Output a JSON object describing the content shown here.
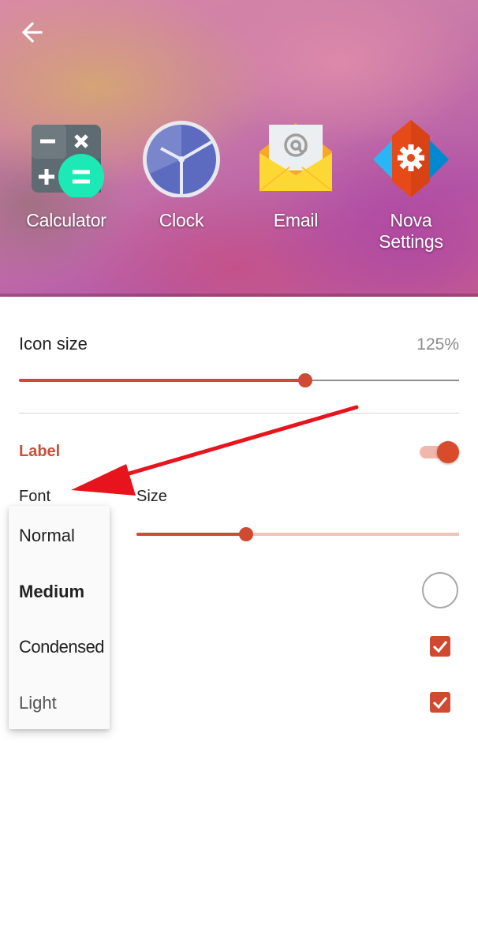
{
  "preview": {
    "apps": [
      {
        "label": "Calculator",
        "icon": "calculator-icon"
      },
      {
        "label": "Clock",
        "icon": "clock-icon"
      },
      {
        "label": "Email",
        "icon": "email-icon"
      },
      {
        "label": "Nova Settings",
        "icon": "nova-settings-icon"
      }
    ]
  },
  "icon_size": {
    "title": "Icon size",
    "value": "125%",
    "slider_fraction": 0.65
  },
  "label_section": {
    "title": "Label",
    "enabled": true,
    "font_label": "Font",
    "size_label": "Size",
    "size_slider_fraction": 0.34,
    "font_menu": [
      "Normal",
      "Medium",
      "Condensed",
      "Light"
    ]
  },
  "colors": {
    "accent": "#cf4a30",
    "toggle_track": "#f0b8ab",
    "annotation_arrow": "#e8141d"
  }
}
